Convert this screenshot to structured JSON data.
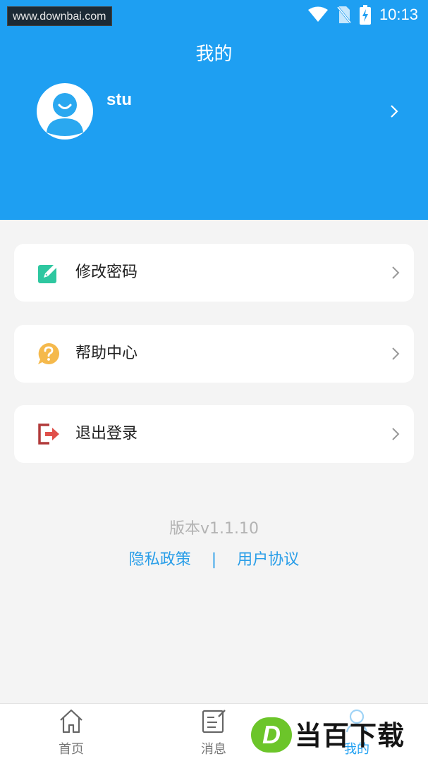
{
  "watermark_top": "www.downbai.com",
  "status_bar": {
    "time": "10:13",
    "icons": [
      "wifi-icon",
      "no-sim-icon",
      "battery-charging-icon"
    ]
  },
  "header": {
    "title": "我的",
    "background": "#1e9ff2"
  },
  "profile": {
    "username": "stu",
    "avatar_icon": "user-avatar-icon"
  },
  "menu": [
    {
      "label": "修改密码",
      "icon": "edit-icon",
      "icon_color": "#2ec7a0"
    },
    {
      "label": "帮助中心",
      "icon": "help-icon",
      "icon_color": "#f5b94c"
    },
    {
      "label": "退出登录",
      "icon": "logout-icon",
      "icon_color": "#b13a3a"
    }
  ],
  "footer": {
    "version": "版本v1.1.10",
    "privacy": "隐私政策",
    "separator": "|",
    "agreement": "用户协议"
  },
  "tabs": [
    {
      "label": "首页",
      "icon": "home-icon",
      "active": false
    },
    {
      "label": "消息",
      "icon": "message-icon",
      "active": false
    },
    {
      "label": "我的",
      "icon": "profile-icon",
      "active": true
    }
  ],
  "watermark_bottom": {
    "badge": "D",
    "text": "当百下载"
  },
  "colors": {
    "accent": "#1e9ff2",
    "link": "#2a9ee8",
    "background": "#f4f4f4"
  }
}
